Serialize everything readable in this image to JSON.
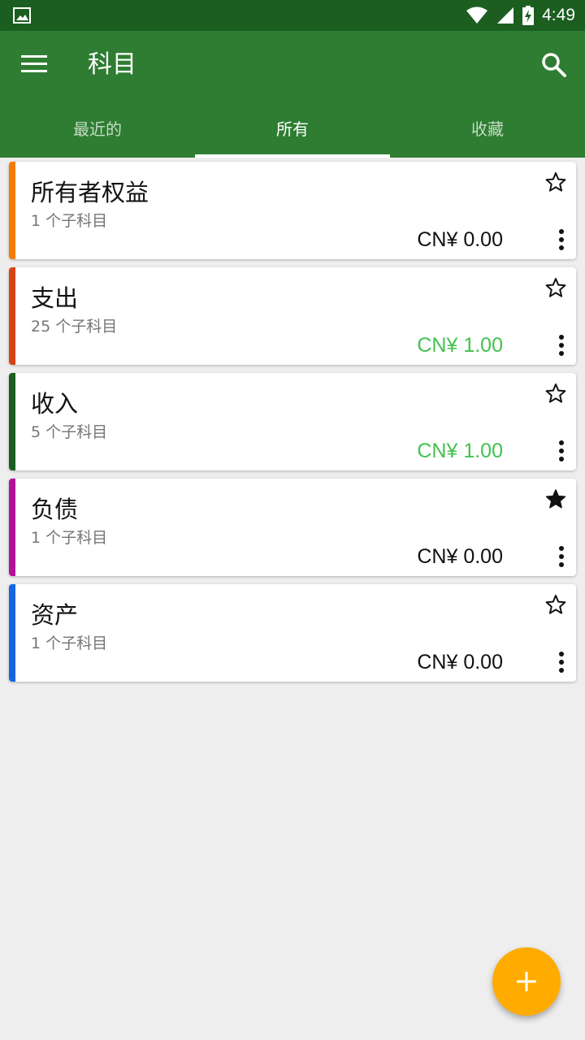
{
  "status_bar": {
    "time": "4:49",
    "icons": [
      "image-icon",
      "wifi-icon",
      "signal-icon",
      "battery-charging-icon"
    ]
  },
  "app_bar": {
    "title": "科目",
    "menu_icon": "menu-icon",
    "search_icon": "search-icon"
  },
  "tabs": [
    {
      "label": "最近的",
      "active": false
    },
    {
      "label": "所有",
      "active": true
    },
    {
      "label": "收藏",
      "active": false
    }
  ],
  "accounts": [
    {
      "name": "所有者权益",
      "subaccounts": "1 个子科目",
      "balance": "CN¥ 0.00",
      "stripe_color": "#f57c00",
      "balance_color": "#111111",
      "favorite": false
    },
    {
      "name": "支出",
      "subaccounts": "25 个子科目",
      "balance": "CN¥ 1.00",
      "stripe_color": "#d84315",
      "balance_color": "#43c24e",
      "favorite": false
    },
    {
      "name": "收入",
      "subaccounts": "5 个子科目",
      "balance": "CN¥ 1.00",
      "stripe_color": "#1b5e20",
      "balance_color": "#43c24e",
      "favorite": false
    },
    {
      "name": "负债",
      "subaccounts": "1 个子科目",
      "balance": "CN¥ 0.00",
      "stripe_color": "#b0129b",
      "balance_color": "#111111",
      "favorite": true
    },
    {
      "name": "资产",
      "subaccounts": "1 个子科目",
      "balance": "CN¥ 0.00",
      "stripe_color": "#1565e0",
      "balance_color": "#111111",
      "favorite": false
    }
  ],
  "fab": {
    "icon": "add-icon",
    "color": "#ffab00"
  },
  "colors": {
    "primary": "#2e7d32",
    "primary_dark": "#1b5e20",
    "accent": "#ffab00"
  }
}
